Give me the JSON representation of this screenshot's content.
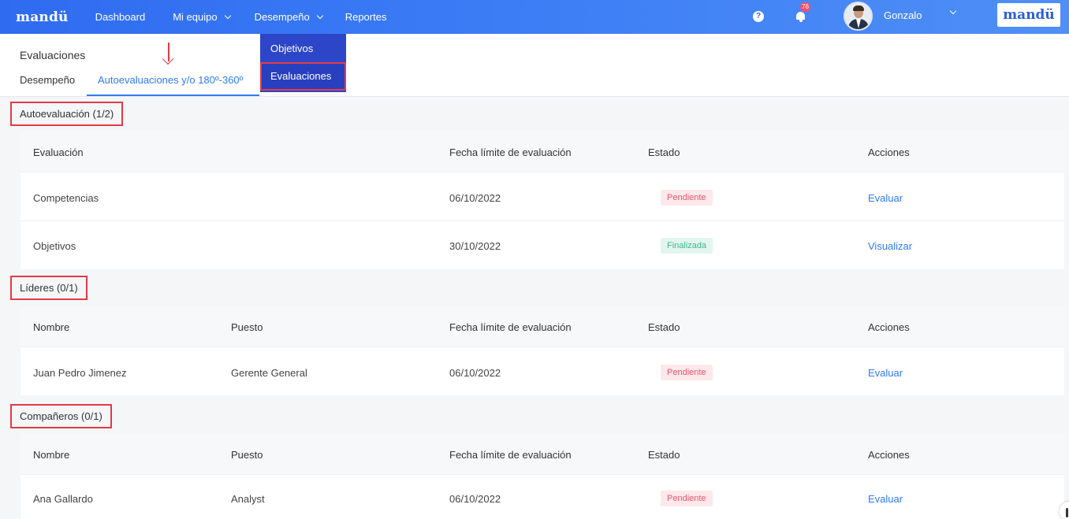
{
  "nav": {
    "logo": "mandü",
    "items": [
      {
        "label": "Dashboard"
      },
      {
        "label": "Mi equipo"
      },
      {
        "label": "Desempeño"
      },
      {
        "label": "Reportes"
      }
    ],
    "help_icon": "?",
    "notifications_count": "76",
    "user_name": "Gonzalo",
    "brand": "mandü"
  },
  "dropdown": {
    "items": [
      {
        "label": "Objetivos"
      },
      {
        "label": "Evaluaciones"
      }
    ]
  },
  "header": {
    "title": "Evaluaciones",
    "tabs": [
      {
        "label": "Desempeño"
      },
      {
        "label": "Autoevaluaciones y/o 180º-360º"
      }
    ]
  },
  "sections": {
    "auto": {
      "label": "Autoevaluación (1/2)",
      "headers": {
        "evaluacion": "Evaluación",
        "fecha": "Fecha límite de evaluación",
        "estado": "Estado",
        "acciones": "Acciones"
      },
      "rows": [
        {
          "evaluacion": "Competencias",
          "fecha": "06/10/2022",
          "estado": "Pendiente",
          "accion": "Evaluar"
        },
        {
          "evaluacion": "Objetivos",
          "fecha": "30/10/2022",
          "estado": "Finalizada",
          "accion": "Visualizar"
        }
      ]
    },
    "lideres": {
      "label": "Líderes (0/1)",
      "headers": {
        "nombre": "Nombre",
        "puesto": "Puesto",
        "fecha": "Fecha límite de evaluación",
        "estado": "Estado",
        "acciones": "Acciones"
      },
      "rows": [
        {
          "nombre": "Juan Pedro Jimenez",
          "puesto": "Gerente General",
          "fecha": "06/10/2022",
          "estado": "Pendiente",
          "accion": "Evaluar"
        }
      ]
    },
    "companeros": {
      "label": "Compañeros (0/1)",
      "headers": {
        "nombre": "Nombre",
        "puesto": "Puesto",
        "fecha": "Fecha límite de evaluación",
        "estado": "Estado",
        "acciones": "Acciones"
      },
      "rows": [
        {
          "nombre": "Ana Gallardo",
          "puesto": "Analyst",
          "fecha": "06/10/2022",
          "estado": "Pendiente",
          "accion": "Evaluar"
        }
      ]
    }
  },
  "colors": {
    "nav_gradient_start": "#2f6bf0",
    "accent": "#2f7bf5",
    "annotation_red": "#e53946",
    "pending_text": "#e8586a",
    "done_text": "#3cb98e"
  }
}
